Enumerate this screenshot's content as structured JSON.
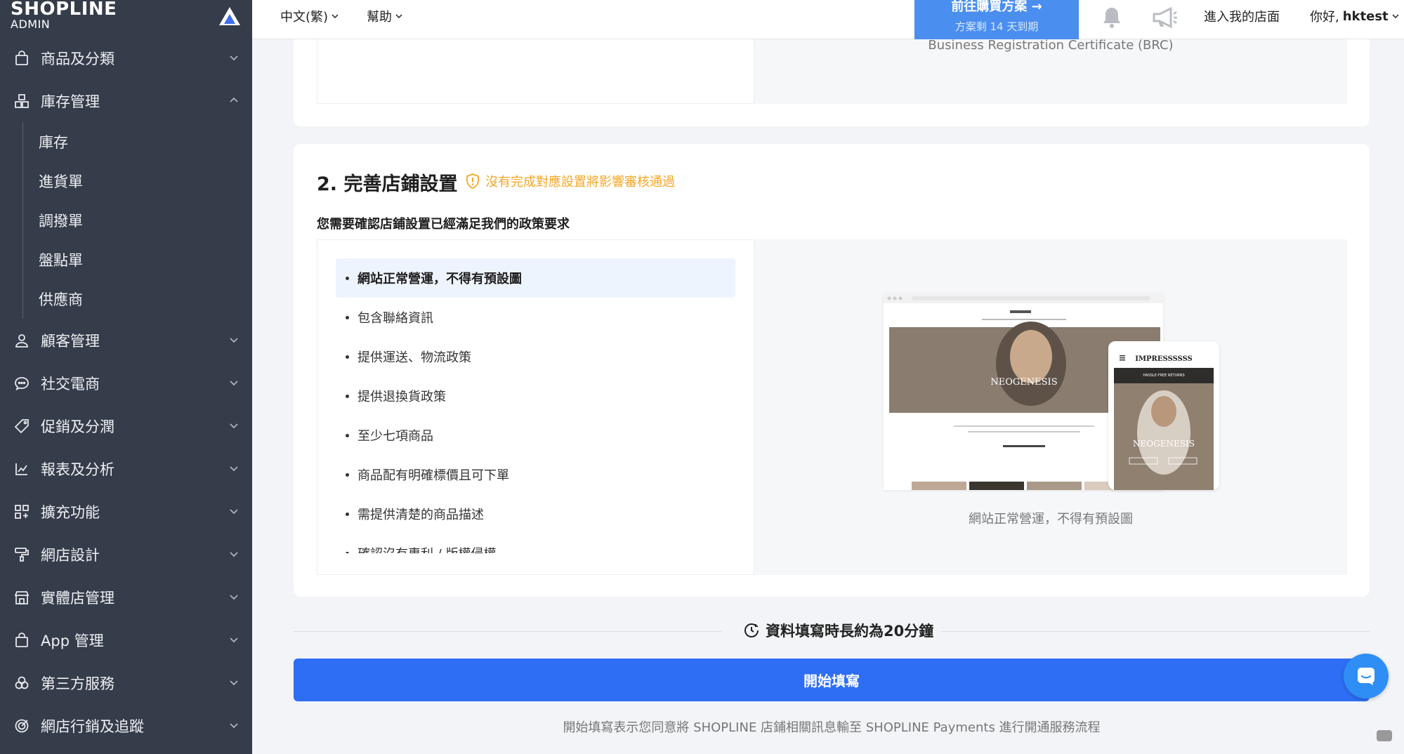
{
  "brand": {
    "name": "SHOPLINE",
    "sub": "ADMIN"
  },
  "sidebar": {
    "items": [
      {
        "label": "商品及分類",
        "icon": "bag-icon"
      },
      {
        "label": "庫存管理",
        "icon": "inventory-icon",
        "expanded": true,
        "children": [
          "庫存",
          "進貨單",
          "調撥單",
          "盤點單",
          "供應商"
        ]
      },
      {
        "label": "顧客管理",
        "icon": "user-icon"
      },
      {
        "label": "社交電商",
        "icon": "chat-icon"
      },
      {
        "label": "促銷及分潤",
        "icon": "tag-icon"
      },
      {
        "label": "報表及分析",
        "icon": "chart-icon"
      },
      {
        "label": "擴充功能",
        "icon": "grid-icon"
      },
      {
        "label": "網店設計",
        "icon": "paint-roller-icon"
      },
      {
        "label": "實體店管理",
        "icon": "store-icon"
      },
      {
        "label": "App 管理",
        "icon": "bag-icon"
      },
      {
        "label": "第三方服務",
        "icon": "cluster-icon"
      },
      {
        "label": "網店行銷及追蹤",
        "icon": "target-icon"
      }
    ]
  },
  "topbar": {
    "language": "中文(繁)",
    "help": "幫助",
    "plan_button": {
      "title": "前往購買方案 →",
      "subtitle": "方案剩 14 天到期"
    },
    "enter_store": "進入我的店面",
    "greeting_prefix": "你好, ",
    "username": "hktest"
  },
  "brc_text": "Business Registration Certificate (BRC)",
  "section": {
    "title": "2. 完善店鋪設置",
    "warning": "沒有完成對應設置將影響審核通過",
    "description": "您需要確認店鋪設置已經滿足我們的政策要求",
    "items": [
      "網站正常營運，不得有預設圖",
      "包含聯絡資訊",
      "提供運送、物流政策",
      "提供退換貨政策",
      "至少七項商品",
      "商品配有明確標價且可下單",
      "需提供清楚的商品描述",
      "確認沒有專利 / 版權侵權"
    ],
    "active_index": 0,
    "preview_caption": "網站正常營運，不得有預設圖",
    "preview": {
      "desktop_banner": "NEOGENESIS",
      "mobile_brand": "IMPRESSSSSS",
      "mobile_tagline": "HASSLE-FREE RETURNS",
      "mobile_banner": "NEOGENESIS"
    }
  },
  "duration_text": "資料填寫時長約為20分鐘",
  "start_button": "開始填寫",
  "consent_text": "開始填寫表示您同意將 SHOPLINE 店鋪相關訊息輸至 SHOPLINE Payments 進行開通服務流程",
  "colors": {
    "sidebar": "#353c4a",
    "primary": "#2e6ef5",
    "warning": "#f5a623",
    "plan": "#4a8ef0"
  }
}
